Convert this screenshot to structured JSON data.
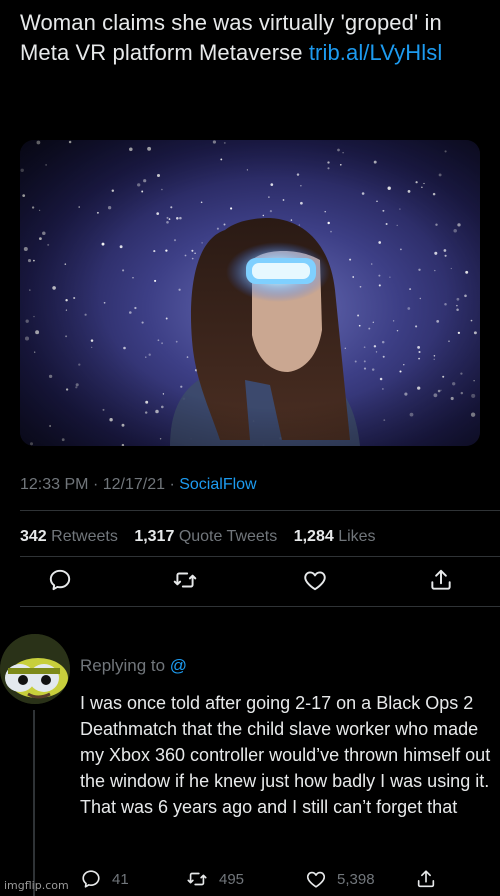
{
  "tweet": {
    "text": "Woman claims she was virtually 'groped' in Meta VR platform Metaverse",
    "link": "trib.al/LVyHlsl",
    "time": "12:33 PM",
    "date": "12/17/21",
    "source": "SocialFlow",
    "retweets_count": "342",
    "retweets_label": "Retweets",
    "quotes_count": "1,317",
    "quotes_label": "Quote Tweets",
    "likes_count": "1,284",
    "likes_label": "Likes"
  },
  "actions": {
    "reply_icon": "reply-icon",
    "retweet_icon": "retweet-icon",
    "like_icon": "heart-icon",
    "share_icon": "share-icon"
  },
  "reply": {
    "replying_to": "Replying to",
    "replying_at": "@",
    "text": "I was once told after going 2-17 on a Black Ops 2 Deathmatch that the child slave worker who made my Xbox 360 controller would’ve thrown himself out the window if he knew just how badly I was using it. That was 6 years ago and I still can’t forget that",
    "reply_count": "41",
    "retweet_count": "495",
    "like_count": "5,398"
  },
  "watermark": "imgflip.com",
  "colors": {
    "background": "#000000",
    "text": "#e7e9ea",
    "muted": "#71767b",
    "link": "#1d9bf0",
    "divider": "#2f3336"
  }
}
